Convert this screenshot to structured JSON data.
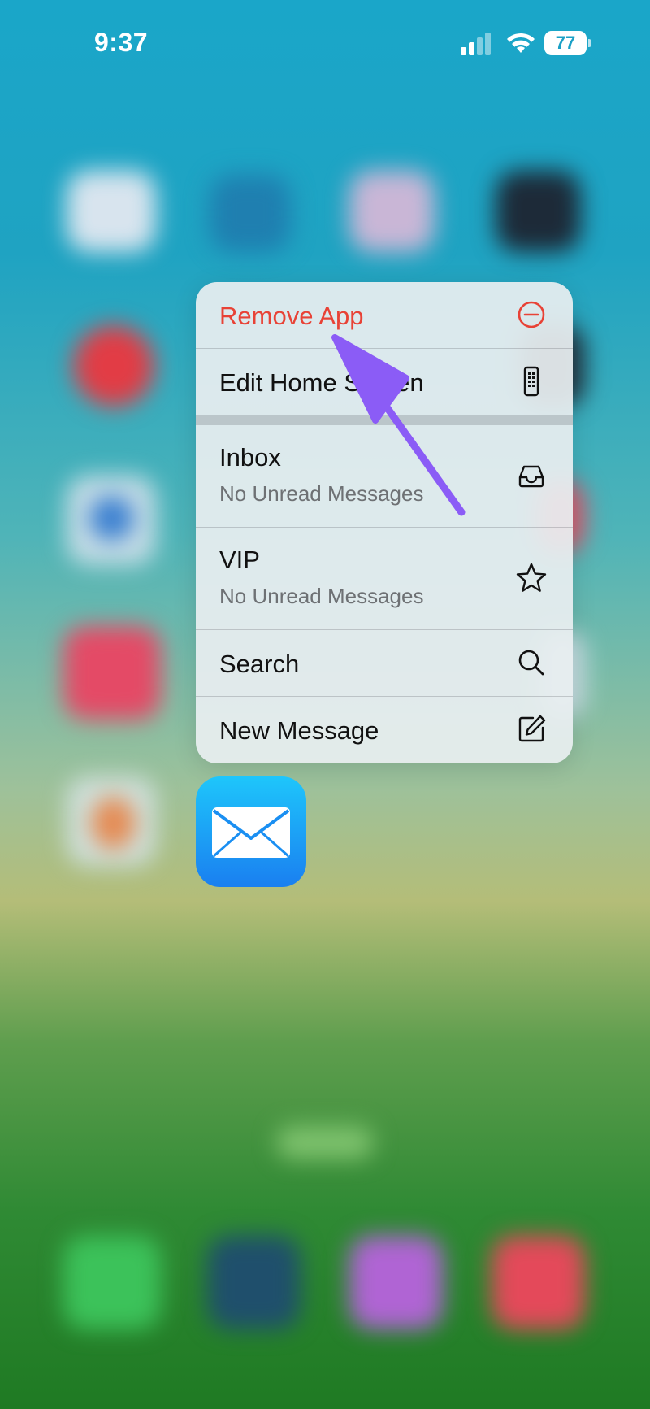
{
  "status_bar": {
    "time": "9:37",
    "battery_percent": "77",
    "signal_bars_active": 2,
    "signal_bars_total": 4
  },
  "context_menu": {
    "items": [
      {
        "label": "Remove App",
        "subtitle": "",
        "icon": "minus-circle-icon",
        "destructive": true
      },
      {
        "label": "Edit Home Screen",
        "subtitle": "",
        "icon": "phone-grid-icon",
        "destructive": false
      },
      {
        "label": "Inbox",
        "subtitle": "No Unread Messages",
        "icon": "tray-icon",
        "destructive": false
      },
      {
        "label": "VIP",
        "subtitle": "No Unread Messages",
        "icon": "star-icon",
        "destructive": false
      },
      {
        "label": "Search",
        "subtitle": "",
        "icon": "magnifier-icon",
        "destructive": false
      },
      {
        "label": "New Message",
        "subtitle": "",
        "icon": "compose-icon",
        "destructive": false
      }
    ]
  },
  "app_icon": {
    "name": "Mail",
    "icon": "envelope-icon"
  },
  "colors": {
    "destructive": "#e84236",
    "annotation_arrow": "#8b5cf6",
    "mail_gradient_top": "#1ec6fb",
    "mail_gradient_bottom": "#1a7ff0"
  }
}
